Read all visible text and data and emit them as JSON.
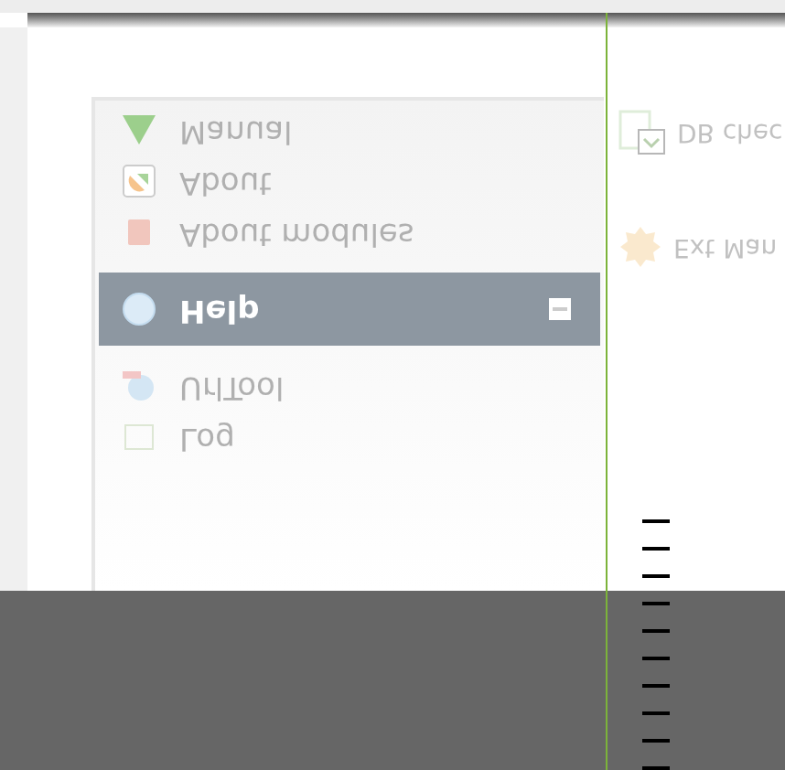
{
  "menu": {
    "items": [
      {
        "label": "Manual",
        "kind": "manual",
        "selected": false
      },
      {
        "label": "About",
        "kind": "about",
        "selected": false
      },
      {
        "label": "About modules",
        "kind": "modules",
        "selected": false
      },
      {
        "label": "Help",
        "kind": "help",
        "selected": true,
        "expanded": true
      },
      {
        "label": "UrlTool",
        "kind": "url",
        "selected": false
      },
      {
        "label": "Log",
        "kind": "log",
        "selected": false
      }
    ]
  },
  "side_items": [
    {
      "label": "DB chec",
      "kind": "db"
    },
    {
      "label": "Ext Man",
      "kind": "ext"
    }
  ]
}
